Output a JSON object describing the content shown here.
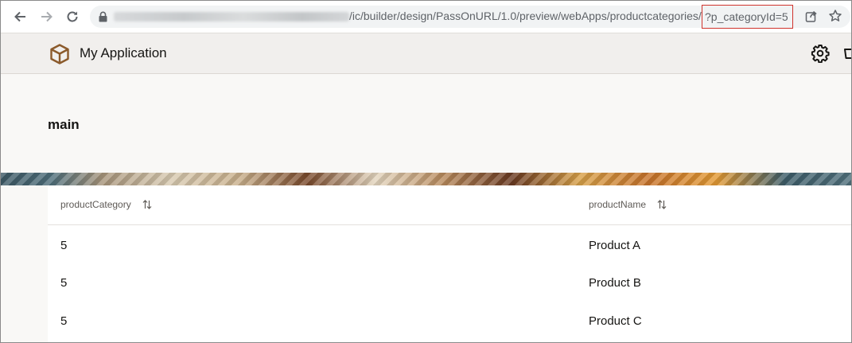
{
  "browser": {
    "url_path": "/ic/builder/design/PassOnURL/1.0/preview/webApps/productcategories/",
    "url_query": "?p_categoryId=5"
  },
  "app": {
    "title": "My Application"
  },
  "page": {
    "title": "main"
  },
  "table": {
    "columns": [
      {
        "label": "productCategory"
      },
      {
        "label": "productName"
      }
    ],
    "rows": [
      {
        "productCategory": "5",
        "productName": "Product A"
      },
      {
        "productCategory": "5",
        "productName": "Product B"
      },
      {
        "productCategory": "5",
        "productName": "Product C"
      }
    ]
  },
  "colors": {
    "header_bg": "#f1efed",
    "page_bg": "#f9f8f6",
    "highlight_border": "#d0332c",
    "logo_brown": "#8b5a2b"
  }
}
